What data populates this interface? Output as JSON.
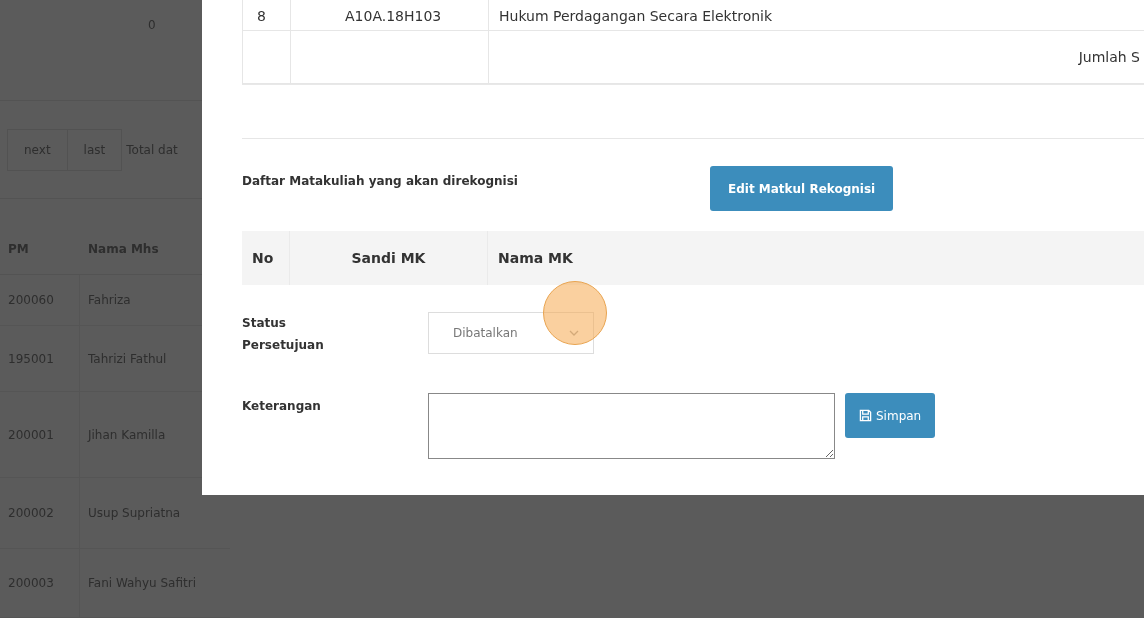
{
  "background": {
    "count_cell": "0",
    "pagination": [
      {
        "label": "next"
      },
      {
        "label": "last"
      }
    ],
    "total_text": "Total dat",
    "table": {
      "columns": [
        "PM",
        "Nama Mhs"
      ],
      "rows": [
        [
          "200060",
          "Fahriza"
        ],
        [
          "195001",
          "Tahrizi Fathul"
        ],
        [
          "200001",
          "Jihan Kamilla"
        ],
        [
          "200002",
          "Usup Supriatna"
        ],
        [
          "200003",
          "Fani Wahyu Safitri"
        ]
      ]
    }
  },
  "modal": {
    "course_table": {
      "rows": [
        {
          "no": "8",
          "code": "A10A.18H103",
          "name": "Hukum Perdagangan Secara Elektronik"
        }
      ],
      "total_label": "Jumlah S"
    },
    "section_title": "Daftar Matakuliah yang akan direkognisi",
    "edit_button": "Edit Matkul Rekognisi",
    "recognition_table": {
      "columns": [
        "No",
        "Sandi MK",
        "Nama MK"
      ]
    },
    "form": {
      "status_label": "Status Persetujuan",
      "status_value": "Dibatalkan",
      "notes_label": "Keterangan",
      "save_button": "Simpan"
    }
  }
}
